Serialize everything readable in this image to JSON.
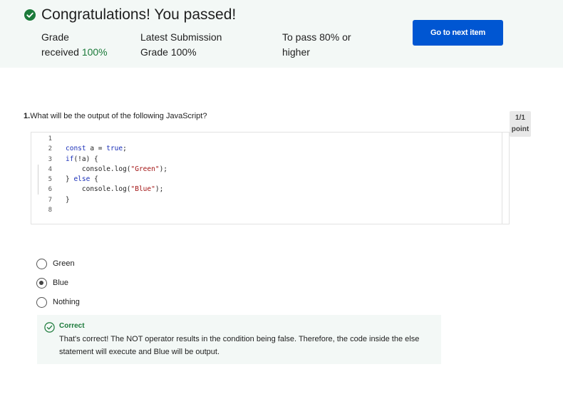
{
  "banner": {
    "title": "Congratulations! You passed!",
    "grade_label_1": "Grade",
    "grade_label_2": "received",
    "grade_value": "100%",
    "latest_label": "Latest Submission",
    "latest_grade_label": "Grade",
    "latest_value": "100%",
    "to_pass_label": "To pass",
    "to_pass_value": "80%",
    "to_pass_suffix_1": "or",
    "to_pass_suffix_2": "higher",
    "next_button": "Go to next item",
    "accent_color": "#1b7a3a",
    "button_color": "#0056d2"
  },
  "question": {
    "number": "1.",
    "text": "What will be the output of the following JavaScript?",
    "points_line_1": "1/1",
    "points_line_2": "point"
  },
  "code": {
    "line_numbers": [
      "1",
      "2",
      "3",
      "4",
      "5",
      "6",
      "7",
      "8"
    ],
    "lines": {
      "l2_kw": "const",
      "l2_rest": " a = ",
      "l2_val": "true",
      "l2_end": ";",
      "l3_kw": "if",
      "l3_rest": "(!a) {",
      "l4_pre": "    console.log(",
      "l4_str": "\"Green\"",
      "l4_end": ");",
      "l5_pre": "} ",
      "l5_kw": "else",
      "l5_end": " {",
      "l6_pre": "    console.log(",
      "l6_str": "\"Blue\"",
      "l6_end": ");",
      "l7": "}"
    }
  },
  "options": [
    {
      "label": "Green",
      "selected": false
    },
    {
      "label": "Blue",
      "selected": true
    },
    {
      "label": "Nothing",
      "selected": false
    }
  ],
  "feedback": {
    "title": "Correct",
    "text": "That's correct! The NOT operator results in the condition being false. Therefore, the code inside the else statement will execute and Blue will be output."
  },
  "icons": {
    "banner": "check-circle-filled-icon",
    "feedback": "check-circle-outline-icon"
  }
}
